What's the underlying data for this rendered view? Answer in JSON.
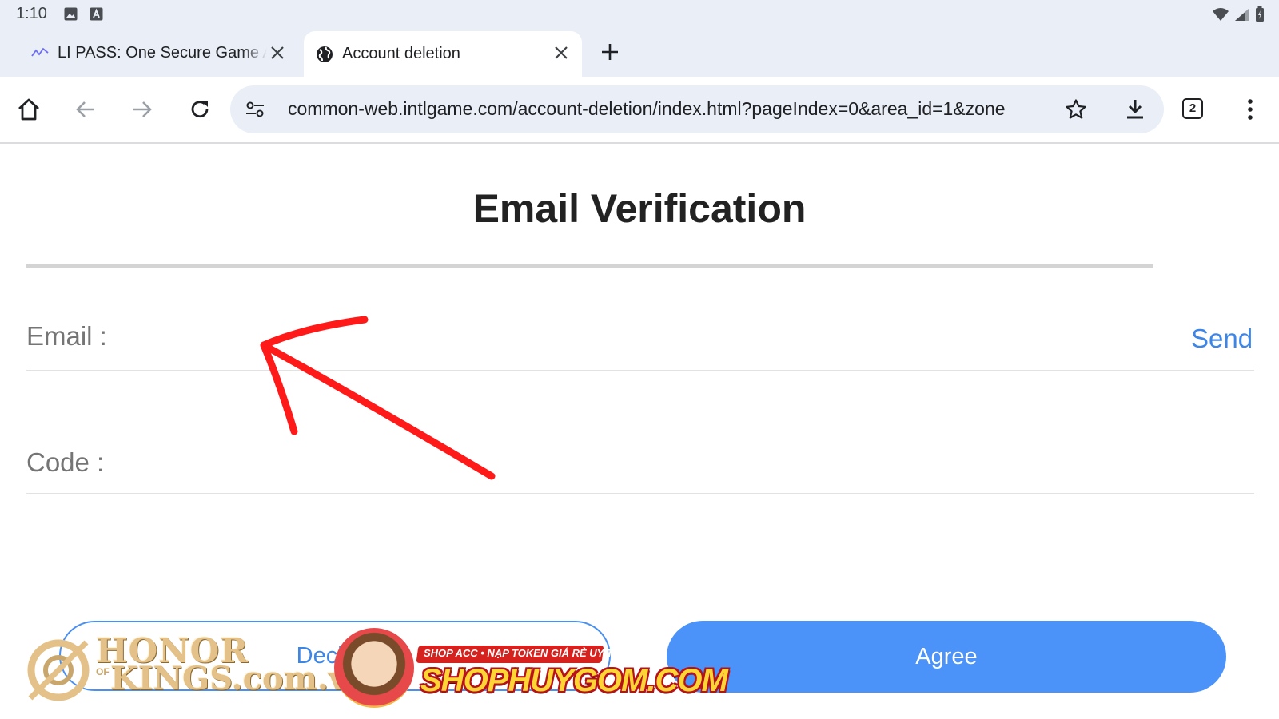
{
  "status_bar": {
    "time": "1:10",
    "left_icons": [
      "image-icon",
      "font-icon"
    ],
    "right_icons": [
      "wifi-icon",
      "cell-signal-icon",
      "battery-icon"
    ]
  },
  "tabs": [
    {
      "title": "LI PASS: One Secure Game Account",
      "active": false,
      "favicon": "li-pass-icon"
    },
    {
      "title": "Account deletion",
      "active": true,
      "favicon": "globe-icon"
    }
  ],
  "toolbar": {
    "url": "common-web.intlgame.com/account-deletion/index.html?pageIndex=0&area_id=1&zone",
    "tab_count": "2"
  },
  "page": {
    "title": "Email Verification",
    "email_label": "Email :",
    "email_value": "",
    "send_label": "Send",
    "code_label": "Code :",
    "code_value": "",
    "decline_label": "Decline",
    "agree_label": "Agree"
  },
  "overlays": {
    "watermark_logo": "HONOR OF KINGS.com.vn",
    "watermark_logo_parts": {
      "line1": "HONOR",
      "of": "OF",
      "line2": "KINGS.com.vn"
    },
    "watermark_shop_tagline": "SHOP ACC • NẠP TOKEN GIÁ RẺ UY TÍN",
    "watermark_shop_brand": "SHOPHUYGOM.COM",
    "annotation_arrow_color": "#ff1a1a"
  },
  "colors": {
    "chrome_bg": "#e9eef7",
    "link_blue": "#3d86e6",
    "agree_bg": "#4b93f8",
    "label_gray": "#757575"
  }
}
